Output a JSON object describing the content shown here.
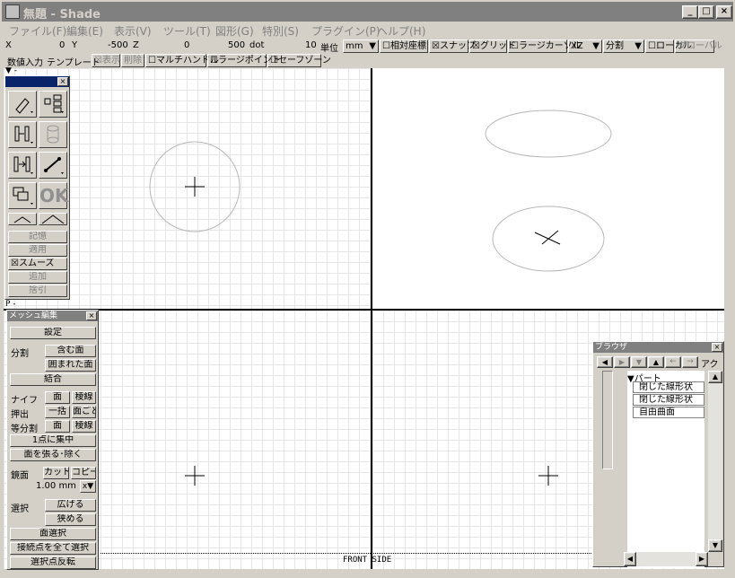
{
  "window": {
    "title": "無題 - Shade",
    "min_label": "_",
    "max_label": "□",
    "close_label": "×"
  },
  "menubar": {
    "items": [
      "ファイル(F)",
      "編集(E)",
      "表示(V)",
      "ツール(T)",
      "図形(G)",
      "特別(S)",
      "プラグイン(P)",
      "ヘルプ(H)"
    ]
  },
  "coordbar": {
    "x_label": "X",
    "x_value": "0",
    "y_label": "Y",
    "y_value": "-500",
    "z_label": "Z",
    "z_value": "0",
    "grid_value": "500",
    "dot_label": "dot",
    "snap_value": "10",
    "unit_label": "単位",
    "unit_value": "mm",
    "relative_coords": "☐相対座標",
    "snap": "☒スナップ",
    "grid": "☒グリッド",
    "large_cursor": "☐ラージカーソル",
    "plane_value": "XZ",
    "split_label": "分割",
    "local": "☐ローカル",
    "global": "グローバル"
  },
  "optionbar": {
    "numeric_input": "数値入力",
    "template": "テンプレート",
    "show": "☒表示",
    "delete": "削除",
    "multi_handle": "☐マルチハンドル",
    "large_point": "☐ラージポイント",
    "safe_zone": "☐セーフゾーン"
  },
  "toolbox": {
    "memory": "記憶",
    "apply": "適用",
    "smooth": "☒スムーズ",
    "add": "追加",
    "subtract": "捨引",
    "ok_label": "OK"
  },
  "viewport_labels": {
    "top_marker": "▼ -",
    "bottom_marker": "P -",
    "front_side": "FRONT SIDE"
  },
  "mesh_palette": {
    "title": "メッシュ編集",
    "settings": "設定",
    "split_label": "分割",
    "include_face": "含む面",
    "enclosed_face": "囲まれた面",
    "combine": "結合",
    "knife_label": "ナイフ",
    "face": "面",
    "edge": "稜線",
    "extrude_label": "押出",
    "all_at_once": "一括",
    "per_face": "面ごと",
    "equal_split_label": "等分割",
    "face2": "面",
    "edge2": "稜線",
    "collapse_point": "1点に集中",
    "fill_remove_face": "面を張る･除く",
    "slice_label": "鏡面",
    "cut": "カット",
    "copy": "コピー",
    "mm_value": "1.00 mm",
    "axis_value": "x",
    "select_label": "選択",
    "expand": "広げる",
    "shrink": "狭める",
    "face_select": "面選択",
    "select_all_connected": "接続点を全て選択",
    "invert_selection": "選択点反転"
  },
  "browser": {
    "title": "ブラウザ",
    "tab_label": "アク",
    "root": "▼パート",
    "items": [
      "閉じた線形状",
      "閉じた線形状",
      "自由曲面"
    ]
  }
}
